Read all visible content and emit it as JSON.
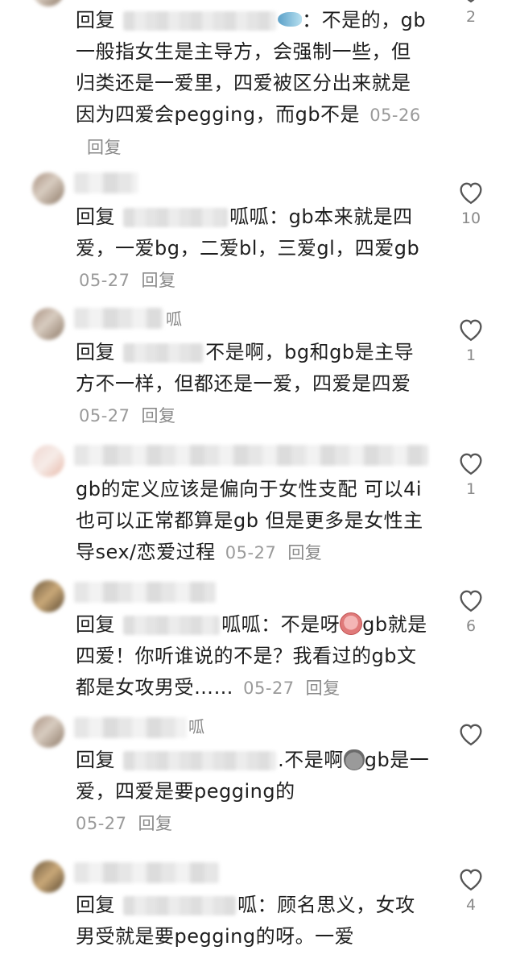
{
  "comments": [
    {
      "reply_prefix": "回复",
      "target_suffix": "：",
      "text": "不是的，gb一般指女生是主导方，会强制一些，但归类还是一爱里，四爱被区分出来就是因为四爱会pegging，而gb不是",
      "date": "05-26",
      "reply_label": "回复",
      "likes": "2",
      "emoji": "fish-emoji"
    },
    {
      "reply_prefix": "回复",
      "target_suffix": "呱呱：",
      "text": "gb本来就是四爱，一爱bg，二爱bl，三爱gl，四爱gb",
      "date": "05-27",
      "reply_label": "回复",
      "likes": "10",
      "name_suffix": ""
    },
    {
      "reply_prefix": "回复",
      "target_suffix": "",
      "text": "不是啊，bg和gb是主导方不一样，但都还是一爱，四爱是四爱",
      "date": "05-27",
      "reply_label": "回复",
      "likes": "1",
      "name_suffix": "呱"
    },
    {
      "text": "gb的定义应该是偏向于女性支配 可以4i也可以正常都算是gb 但是更多是女性主导sex/恋爱过程",
      "date": "05-27",
      "reply_label": "回复",
      "likes": "1"
    },
    {
      "reply_prefix": "回复",
      "target_suffix": "呱呱：",
      "text_before_emoji": "不是呀",
      "text_after_emoji": "gb就是四爱！你听谁说的不是？我看过的gb文都是女攻男受……",
      "date": "05-27",
      "reply_label": "回复",
      "likes": "6",
      "emoji": "crying-emoji"
    },
    {
      "reply_prefix": "回复",
      "target_suffix": ".",
      "text_before_emoji": "不是啊",
      "text_after_emoji": "gb是一爱，四爱是要pegging的",
      "date": "05-27",
      "reply_label": "回复",
      "likes": "",
      "name_suffix": "呱",
      "emoji": "bag-emoji"
    },
    {
      "reply_prefix": "回复",
      "target_suffix": "呱：",
      "text": "顾名思义，女攻男受就是要pegging的呀。一爱",
      "likes": "4"
    }
  ]
}
